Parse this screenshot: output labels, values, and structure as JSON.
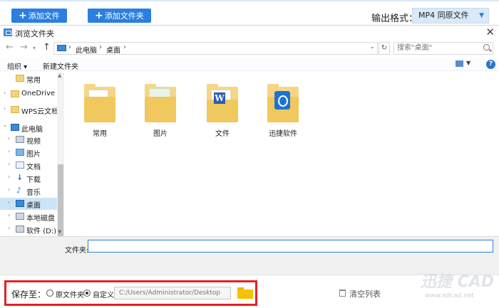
{
  "app": {
    "add_file_label": "添加文件",
    "add_folder_label": "添加文件夹",
    "output_format_label": "输出格式：",
    "output_format_value": "MP4  同原文件"
  },
  "dialog": {
    "title": "浏览文件夹",
    "breadcrumb": [
      "此电脑",
      "桌面"
    ],
    "search_placeholder": "搜索\"桌面\"",
    "commands": {
      "organize": "组织 ▾",
      "new_folder": "新建文件夹"
    },
    "tree": [
      {
        "label": "常用",
        "icon": "folder-icon",
        "indent": 1,
        "expander": ""
      },
      {
        "label": "OneDrive",
        "icon": "folder-icon",
        "indent": 0,
        "expander": "›"
      },
      {
        "label": "WPS云文档",
        "icon": "folder-icon",
        "indent": 0,
        "expander": "›"
      },
      {
        "label": "此电脑",
        "icon": "computer-icon",
        "indent": 0,
        "expander": "⌄"
      },
      {
        "label": "视频",
        "icon": "video-icon",
        "indent": 1,
        "expander": "›"
      },
      {
        "label": "图片",
        "icon": "image-icon",
        "indent": 1,
        "expander": "›"
      },
      {
        "label": "文档",
        "icon": "document-icon",
        "indent": 1,
        "expander": "›"
      },
      {
        "label": "下载",
        "icon": "download-icon",
        "indent": 1,
        "expander": "›"
      },
      {
        "label": "音乐",
        "icon": "music-icon",
        "indent": 1,
        "expander": "›"
      },
      {
        "label": "桌面",
        "icon": "desktop-icon",
        "indent": 1,
        "expander": "›",
        "selected": true
      },
      {
        "label": "本地磁盘 (",
        "icon": "drive-icon",
        "indent": 1,
        "expander": "›"
      },
      {
        "label": "软件 (D:)",
        "icon": "drive-icon",
        "indent": 1,
        "expander": "›"
      }
    ],
    "items": [
      {
        "label": "常用",
        "icon": "folder-icon"
      },
      {
        "label": "图片",
        "icon": "image-folder-icon"
      },
      {
        "label": "文件",
        "icon": "word-folder-icon"
      },
      {
        "label": "迅捷软件",
        "icon": "app-folder-icon"
      }
    ],
    "folder_field_label": "文件夹:",
    "folder_field_value": ""
  },
  "bottom": {
    "save_to_label": "保存至：",
    "radio_original": "原文件夹",
    "radio_custom": "自定义",
    "save_path": "C:/Users/Administrator/Desktop",
    "clear_list_label": "清空列表"
  },
  "watermark": {
    "main": "迅捷 CAD",
    "sub": "www.xdcad.net"
  }
}
